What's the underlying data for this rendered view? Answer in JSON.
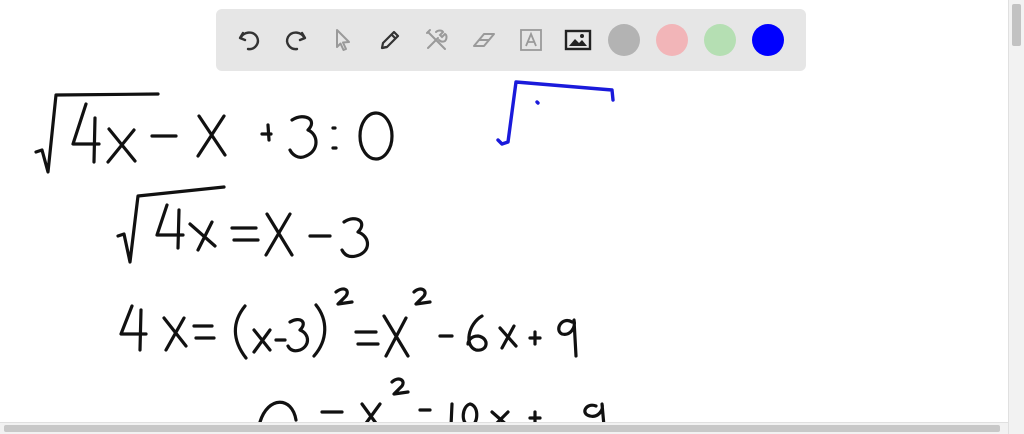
{
  "toolbar": {
    "tools": [
      {
        "icon": "undo-icon"
      },
      {
        "icon": "redo-icon"
      },
      {
        "icon": "pointer-icon"
      },
      {
        "icon": "pencil-icon"
      },
      {
        "icon": "tools-icon"
      },
      {
        "icon": "eraser-icon"
      },
      {
        "icon": "text-box-icon"
      },
      {
        "icon": "image-icon"
      }
    ],
    "colors": [
      "#b3b3b3",
      "#f2b5b8",
      "#b5dfb3",
      "#0000ff"
    ],
    "selected_color": "#0000ff"
  },
  "whiteboard": {
    "ink_color_black": "#111111",
    "ink_color_blue": "#1a1adb"
  }
}
